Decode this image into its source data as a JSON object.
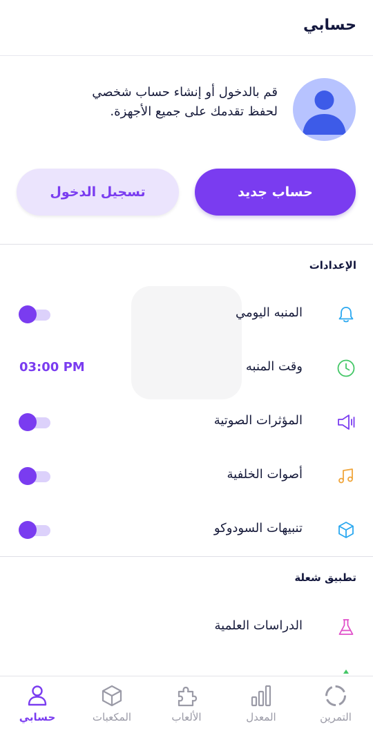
{
  "header": {
    "title": "حسابي"
  },
  "profile": {
    "line1": "قم بالدخول أو إنشاء حساب شخصي",
    "line2": "لحفظ تقدمك على جميع الأجهزة.",
    "new_account_label": "حساب جديد",
    "login_label": "تسجيل الدخول"
  },
  "settings": {
    "title": "الإعدادات",
    "items": [
      {
        "label": "المنبه اليومي",
        "icon": "bell-icon",
        "toggle_on": true
      },
      {
        "label": "وقت المنبه",
        "icon": "clock-icon",
        "value": "03:00 PM"
      },
      {
        "label": "المؤثرات الصوتية",
        "icon": "speaker-icon",
        "toggle_on": true
      },
      {
        "label": "أصوات الخلفية",
        "icon": "music-note-icon",
        "toggle_on": true
      },
      {
        "label": "تنبيهات السودوكو",
        "icon": "cube-icon",
        "toggle_on": true
      }
    ]
  },
  "app_section": {
    "title": "تطبيق شعلة",
    "items": [
      {
        "label": "الدراسات العلمية",
        "icon": "flask-icon"
      }
    ]
  },
  "nav": {
    "items": [
      {
        "label": "حسابي",
        "icon": "user-icon",
        "active": true
      },
      {
        "label": "المكعبات",
        "icon": "cube-icon",
        "active": false
      },
      {
        "label": "الألعاب",
        "icon": "puzzle-icon",
        "active": false
      },
      {
        "label": "المعدل",
        "icon": "bar-chart-icon",
        "active": false
      },
      {
        "label": "التمرين",
        "icon": "circle-dashed-icon",
        "active": false
      }
    ]
  },
  "colors": {
    "accent": "#7a3cf0",
    "accent_light": "#ebe4fd",
    "avatar_bg": "#b7c3ff",
    "avatar_fg": "#3d5be8",
    "bell": "#2aa8f0",
    "clock": "#44c767",
    "speaker": "#7a3cf0",
    "music": "#f0a53a",
    "cube": "#2aa8f0",
    "flask": "#e04fc9"
  }
}
